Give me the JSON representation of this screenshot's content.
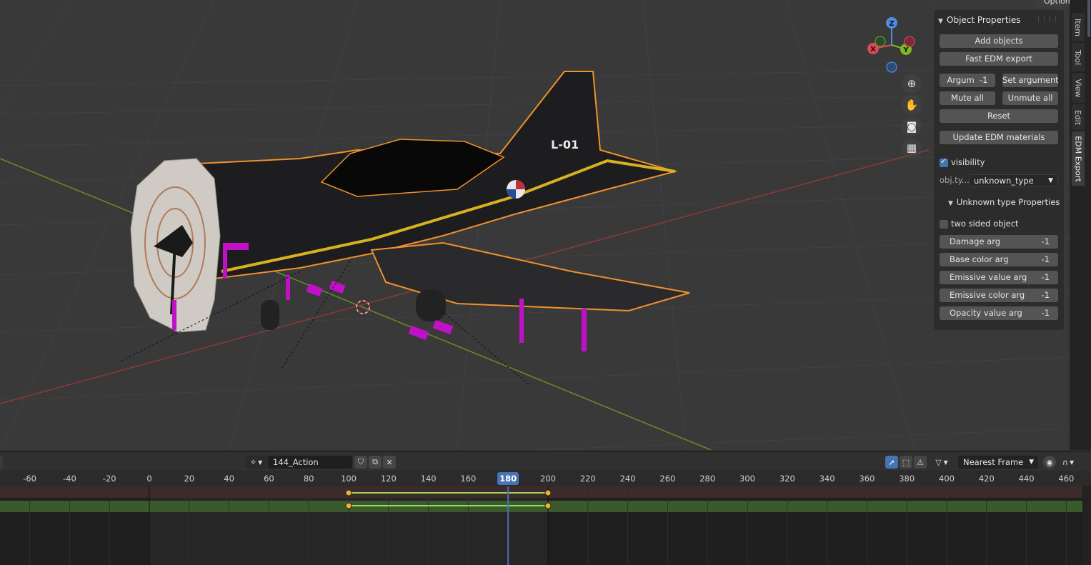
{
  "header": {
    "options_label": "Options"
  },
  "viewport": {
    "aircraft_tail_code": "L-01",
    "gizmo": {
      "z": "Z",
      "x": "X",
      "y": "Y"
    }
  },
  "npanel": {
    "title": "Object Properties",
    "buttons": {
      "add_objects": "Add objects",
      "fast_export": "Fast EDM export",
      "argum": "Argum",
      "argum_value": "-1",
      "set_argument": "Set argument",
      "mute_all": "Mute all",
      "unmute_all": "Unmute all",
      "reset": "Reset",
      "update_materials": "Update EDM materials"
    },
    "visibility_label": "visibility",
    "visibility_checked": true,
    "obj_type_label": "obj.ty...",
    "obj_type_value": "unknown_type",
    "subpanel_title": "Unknown type Properties",
    "two_sided_label": "two sided object",
    "two_sided_checked": false,
    "args": [
      {
        "label": "Damage arg",
        "value": "-1"
      },
      {
        "label": "Base color arg",
        "value": "-1"
      },
      {
        "label": "Emissive value arg",
        "value": "-1"
      },
      {
        "label": "Emissive color arg",
        "value": "-1"
      },
      {
        "label": "Opacity value arg",
        "value": "-1"
      }
    ]
  },
  "tabs": [
    "Item",
    "Tool",
    "View",
    "Edit",
    "EDM Export"
  ],
  "active_tab": "EDM Export",
  "timeline": {
    "action_name": "144_Action",
    "snap_mode": "Nearest Frame",
    "current_frame": "180",
    "ticks": [
      "-60",
      "-40",
      "-20",
      "0",
      "20",
      "40",
      "60",
      "80",
      "100",
      "120",
      "140",
      "160",
      "180",
      "200",
      "220",
      "240",
      "260",
      "280",
      "300",
      "320",
      "340",
      "360",
      "380",
      "400",
      "420",
      "440",
      "460"
    ],
    "keyframes": [
      100,
      200
    ],
    "colors": {
      "playhead": "#4772b3",
      "keyframe": "#f2b134",
      "track_red": "#3d2a2a",
      "track_green": "#3a5a2e"
    }
  }
}
